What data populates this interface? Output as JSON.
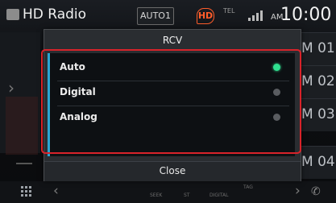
{
  "status": {
    "app_title": "HD Radio",
    "band": "AUTO1",
    "hd_logo": "HD",
    "tel_info": "TEL",
    "ampm": "AM",
    "time": "10:00"
  },
  "presets": [
    "M 01",
    "M 02",
    "M 03",
    "M 04"
  ],
  "dialog": {
    "title": "RCV",
    "options": [
      {
        "label": "Auto",
        "selected": true
      },
      {
        "label": "Digital",
        "selected": false
      },
      {
        "label": "Analog",
        "selected": false
      }
    ],
    "close_label": "Close"
  },
  "bottom_bar": {
    "labels": [
      "SEEK",
      "ST",
      "DIGITAL",
      "TAG"
    ]
  },
  "colors": {
    "selected_radio": "#2fe08f",
    "selection_bar": "#2aa6d4",
    "annotation_frame": "#d8232a",
    "hd_logo": "#ff5d2a"
  }
}
